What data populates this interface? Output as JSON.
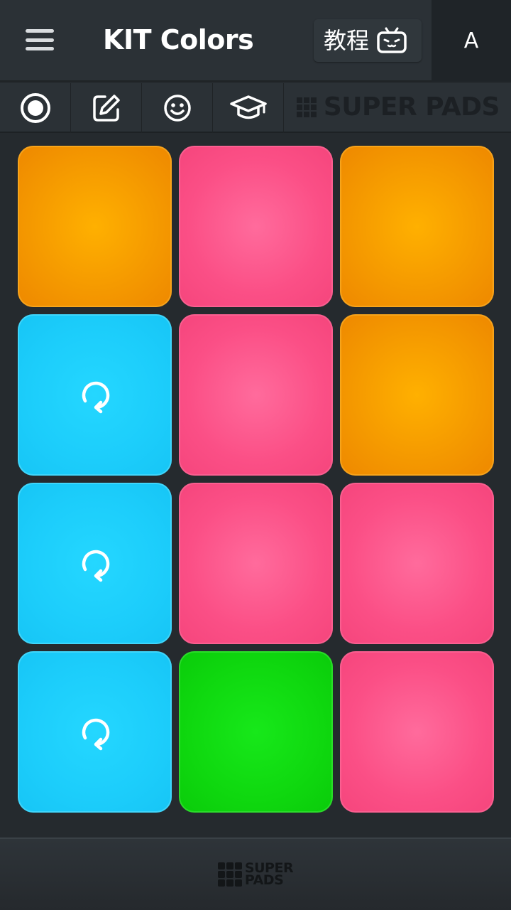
{
  "header": {
    "title": "KIT Colors",
    "tutorial_label": "教程",
    "account_letter": "A"
  },
  "toolbar": {
    "tools": [
      "record-icon",
      "edit-icon",
      "smiley-icon",
      "graduation-cap-icon"
    ],
    "brand_text": "SUPER PADS"
  },
  "pads": [
    {
      "color": "orange",
      "loop": false
    },
    {
      "color": "pink",
      "loop": false
    },
    {
      "color": "orange",
      "loop": false
    },
    {
      "color": "blue",
      "loop": true
    },
    {
      "color": "pink",
      "loop": false
    },
    {
      "color": "orange",
      "loop": false
    },
    {
      "color": "blue",
      "loop": true
    },
    {
      "color": "pink",
      "loop": false
    },
    {
      "color": "pink",
      "loop": false
    },
    {
      "color": "blue",
      "loop": true
    },
    {
      "color": "green",
      "loop": false
    },
    {
      "color": "pink",
      "loop": false
    }
  ],
  "colors": {
    "orange": "#f59a00",
    "pink": "#fb4f86",
    "blue": "#1ccdfb",
    "green": "#0fd80f",
    "background": "#252a2e"
  },
  "footer": {
    "logo_line1": "SUPER",
    "logo_line2": "PADS"
  }
}
